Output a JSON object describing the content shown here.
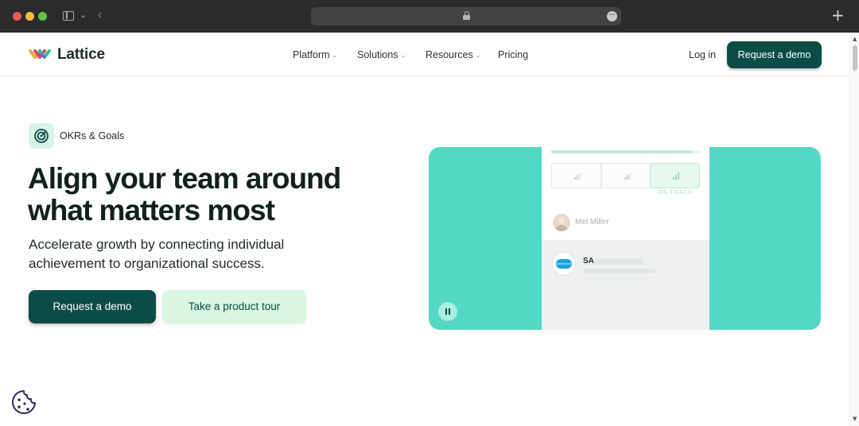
{
  "site": {
    "brand": "Lattice",
    "nav": [
      {
        "label": "Platform",
        "has_dropdown": true
      },
      {
        "label": "Solutions",
        "has_dropdown": true
      },
      {
        "label": "Resources",
        "has_dropdown": true
      },
      {
        "label": "Pricing",
        "has_dropdown": false
      }
    ],
    "login_label": "Log in",
    "demo_label": "Request a demo"
  },
  "hero": {
    "badge": "OKRs & Goals",
    "headline_line1": "Align your team around",
    "headline_line2": "what matters most",
    "subhead": "Accelerate growth by connecting individual achievement to organizational success.",
    "primary_cta": "Request a demo",
    "secondary_cta": "Take a product tour"
  },
  "media": {
    "status_label": "ON TRACK",
    "person_name": "Mel Miller",
    "company_initials": "SA",
    "company_logo_text": "salesforce",
    "progress": 0.95
  },
  "icons": {
    "logo": "lattice-logo",
    "badge": "target-icon",
    "cookie": "cookie-icon",
    "pause": "pause-icon",
    "lock": "lock-icon"
  },
  "colors": {
    "primary": "#0b4d45",
    "secondary_bg": "#d9f6e3",
    "media_bg": "#52d8c5"
  }
}
